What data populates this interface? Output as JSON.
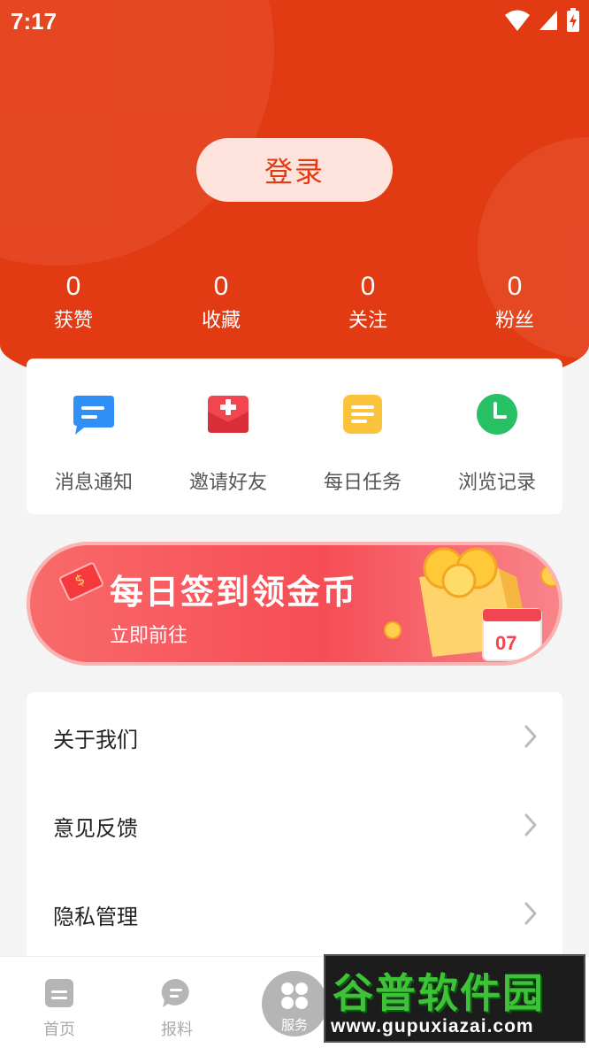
{
  "status_bar": {
    "time": "7:17"
  },
  "header": {
    "login_label": "登录"
  },
  "stats": [
    {
      "value": "0",
      "label": "获赞"
    },
    {
      "value": "0",
      "label": "收藏"
    },
    {
      "value": "0",
      "label": "关注"
    },
    {
      "value": "0",
      "label": "粉丝"
    }
  ],
  "quick_actions": [
    {
      "label": "消息通知",
      "icon": "message-icon",
      "color": "#2f8ff7"
    },
    {
      "label": "邀请好友",
      "icon": "invite-envelope-icon",
      "color": "#f2454f"
    },
    {
      "label": "每日任务",
      "icon": "task-note-icon",
      "color": "#fbc33c"
    },
    {
      "label": "浏览记录",
      "icon": "history-clock-icon",
      "color": "#27c064"
    }
  ],
  "banner": {
    "title": "每日签到领金币",
    "subtitle": "立即前往",
    "calendar_day": "07"
  },
  "menu": [
    {
      "label": "关于我们"
    },
    {
      "label": "意见反馈"
    },
    {
      "label": "隐私管理"
    }
  ],
  "bottom_nav": {
    "home": "首页",
    "report": "报料",
    "service": "服务"
  },
  "watermark": {
    "title": "谷普软件园",
    "url": "www.gupuxiazai.com"
  },
  "colors": {
    "brand": "#e23a12",
    "login_bg": "#fde3dc",
    "banner": "#f64d55"
  }
}
